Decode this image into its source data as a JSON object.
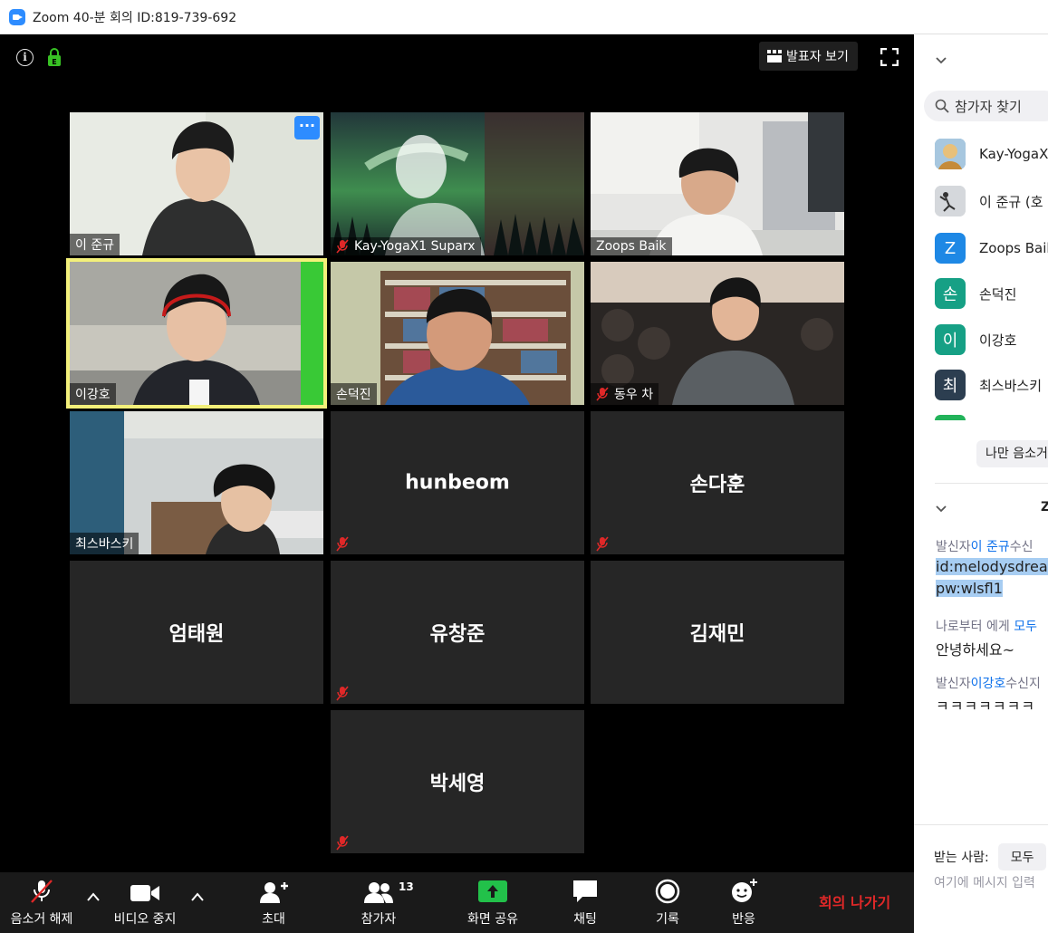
{
  "window": {
    "title": "Zoom 40-분 회의 ID:819-739-692"
  },
  "top_controls": {
    "speaker_view_label": "발표자 보기"
  },
  "tiles": [
    {
      "name": "이 준규"
    },
    {
      "name": "Kay-YogaX1 Suparx"
    },
    {
      "name": "Zoops Baik"
    },
    {
      "name": "이강호"
    },
    {
      "name": "손덕진"
    },
    {
      "name": "동우 차"
    },
    {
      "name": "최스바스키"
    },
    {
      "name": "hunbeom"
    },
    {
      "name": "손다훈"
    },
    {
      "name": "엄태원"
    },
    {
      "name": "유창준"
    },
    {
      "name": "김재민"
    },
    {
      "name": "박세영"
    }
  ],
  "toolbar": {
    "unmute_label": "음소거 해제",
    "stop_video_label": "비디오 중지",
    "invite_label": "초대",
    "participants_label": "참가자",
    "participants_count": "13",
    "share_label": "화면 공유",
    "chat_label": "채팅",
    "record_label": "기록",
    "reactions_label": "반응",
    "leave_label": "회의 나가기"
  },
  "panel": {
    "search_placeholder": "참가자 찾기",
    "participants": [
      {
        "name": "Kay-YogaX",
        "avatar": "",
        "color": "#c9a24a"
      },
      {
        "name": "이 준규 (호",
        "avatar": "",
        "color": "#8a8f99"
      },
      {
        "name": "Zoops Baik",
        "avatar": "Z",
        "color": "#1e88e5"
      },
      {
        "name": "손덕진",
        "avatar": "손",
        "color": "#16a085"
      },
      {
        "name": "이강호",
        "avatar": "이",
        "color": "#16a085"
      },
      {
        "name": "최스바스키",
        "avatar": "최",
        "color": "#2c3e50"
      }
    ],
    "mute_me_label": "나만 음소거",
    "chat_section_initial": "Z",
    "chat": [
      {
        "prefix": "발신자",
        "sender": "이 준규",
        "suffix": "수신"
      },
      {
        "line1": "id:melodysdrea",
        "line2": "pw:wlsfl1"
      },
      {
        "prefix": "나로부터 에게 ",
        "sender": "모두"
      },
      {
        "text": "안녕하세요~"
      },
      {
        "prefix": "발신자",
        "sender": "이강호",
        "suffix": "수신지"
      },
      {
        "text": "ㅋㅋㅋㅋㅋㅋㅋ"
      }
    ],
    "receiver_label": "받는 사람:",
    "receiver_value": "모두",
    "input_placeholder": "여기에 메시지 입력"
  }
}
